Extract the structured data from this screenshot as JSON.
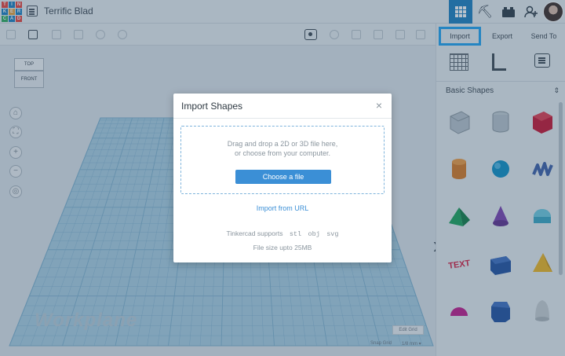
{
  "app": {
    "logo_letters": [
      "T",
      "I",
      "N",
      "K",
      "E",
      "R",
      "C",
      "A",
      "D"
    ],
    "logo_colors": [
      "#e8413a",
      "#1a7fc0",
      "#e8413a",
      "#1a7fc0",
      "#e8a23a",
      "#1a7fc0",
      "#2cac5c",
      "#1a7fc0",
      "#e8413a"
    ],
    "accent": "#1a7fc0"
  },
  "header": {
    "document_title": "Terrific Blad",
    "icons": [
      "document-icon",
      "grid-view-icon",
      "pickaxe-icon",
      "brick-icon",
      "add-user-icon",
      "user-avatar"
    ]
  },
  "right_panel": {
    "tabs": [
      {
        "label": "Import",
        "active": true
      },
      {
        "label": "Export"
      },
      {
        "label": "Send To"
      }
    ],
    "tool_icons": [
      "workplane-icon",
      "ruler-icon",
      "notes-icon"
    ],
    "shape_category": "Basic Shapes",
    "shapes": [
      "box-hole",
      "cylinder-hole",
      "box",
      "cylinder",
      "sphere",
      "scribble",
      "pyramid",
      "cone",
      "roof",
      "text",
      "wedge",
      "pyramid-yellow",
      "half-sphere",
      "polygon",
      "paraboloid"
    ]
  },
  "viewport": {
    "view_cube": {
      "top": "TOP",
      "front": "FRONT"
    },
    "workplane_label": "Workplane",
    "edit_grid": "Edit Grid",
    "snap_grid_label": "Snap Grid",
    "snap_grid_value": "1/8 mm ▾"
  },
  "modal": {
    "title": "Import Shapes",
    "close": "×",
    "drop_line1": "Drag and drop a 2D or 3D file here,",
    "drop_line2": "or choose from your computer.",
    "choose_button": "Choose a file",
    "import_url": "Import from URL",
    "supports_label": "Tinkercad supports",
    "formats": [
      "stl",
      "obj",
      "svg"
    ],
    "file_size": "File size upto 25MB"
  }
}
